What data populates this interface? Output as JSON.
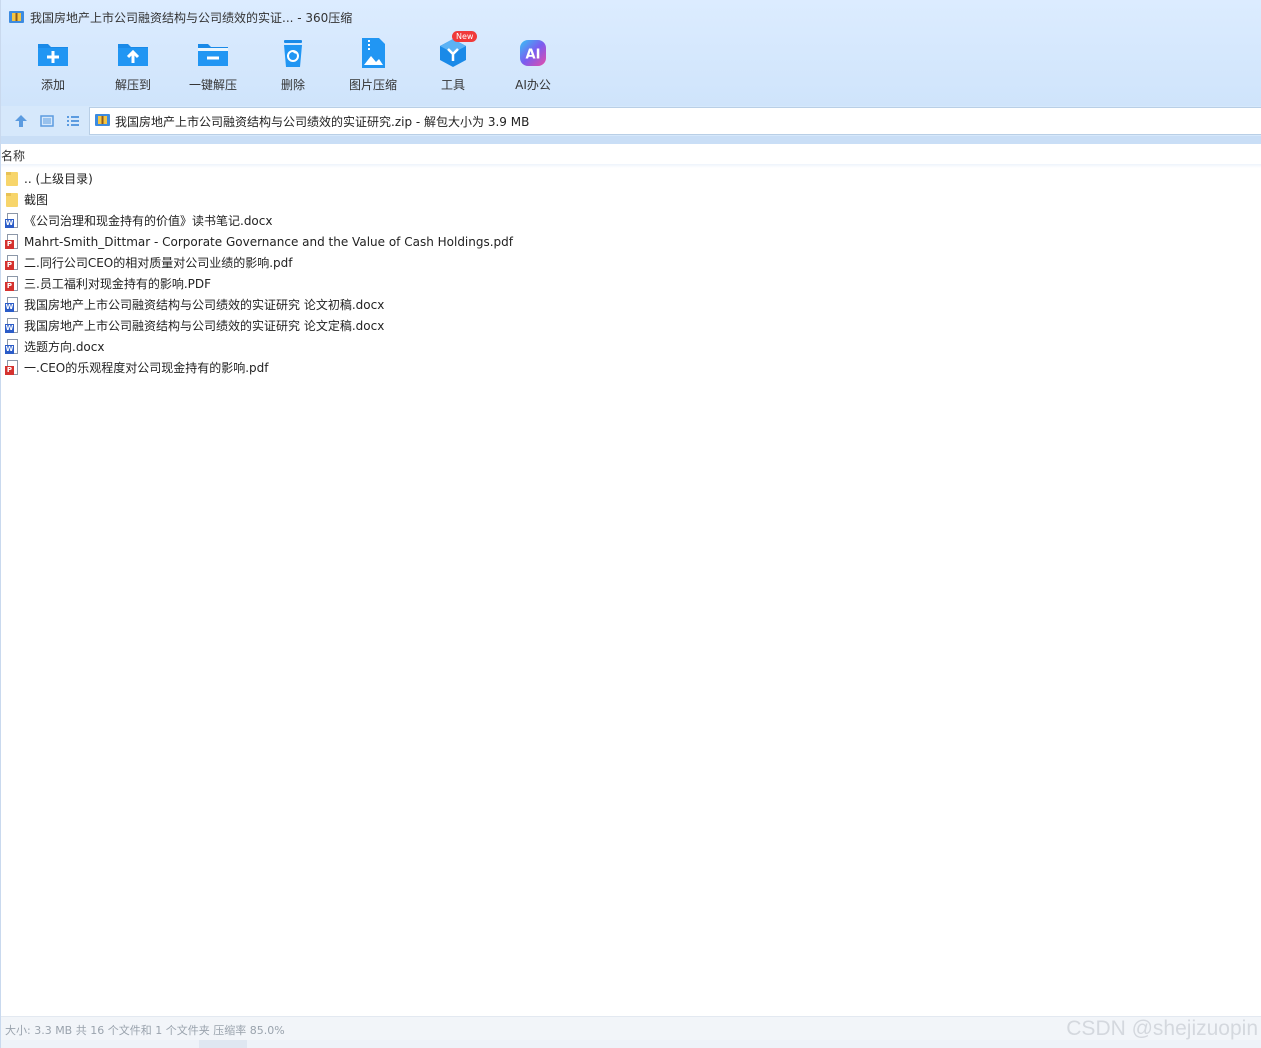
{
  "window": {
    "title": "我国房地产上市公司融资结构与公司绩效的实证... - 360压缩"
  },
  "toolbar": [
    {
      "id": "add",
      "label": "添加",
      "icon": "add-folder-icon"
    },
    {
      "id": "extract-to",
      "label": "解压到",
      "icon": "extract-folder-icon"
    },
    {
      "id": "one-click-extract",
      "label": "一键解压",
      "icon": "one-click-extract-icon"
    },
    {
      "id": "delete",
      "label": "删除",
      "icon": "recycle-bin-icon"
    },
    {
      "id": "image-compress",
      "label": "图片压缩",
      "icon": "image-zip-icon"
    },
    {
      "id": "tools",
      "label": "工具",
      "icon": "tools-cube-icon",
      "badge": "New"
    },
    {
      "id": "ai-office",
      "label": "AI办公",
      "icon": "ai-icon",
      "icon_text": "AI"
    }
  ],
  "addressbar": {
    "path": "我国房地产上市公司融资结构与公司绩效的实证研究.zip - 解包大小为 3.9 MB"
  },
  "list": {
    "column_header": "名称",
    "rows": [
      {
        "name": ".. (上级目录)",
        "type": "folder"
      },
      {
        "name": "截图",
        "type": "folder"
      },
      {
        "name": "《公司治理和现金持有的价值》读书笔记.docx",
        "type": "docx"
      },
      {
        "name": "Mahrt-Smith_Dittmar - Corporate Governance and the Value of Cash Holdings.pdf",
        "type": "pdf"
      },
      {
        "name": "二.同行公司CEO的相对质量对公司业绩的影响.pdf",
        "type": "pdf"
      },
      {
        "name": "三.员工福利对现金持有的影响.PDF",
        "type": "pdf"
      },
      {
        "name": "我国房地产上市公司融资结构与公司绩效的实证研究 论文初稿.docx",
        "type": "docx"
      },
      {
        "name": "我国房地产上市公司融资结构与公司绩效的实证研究 论文定稿.docx",
        "type": "docx"
      },
      {
        "name": "选题方向.docx",
        "type": "docx"
      },
      {
        "name": "一.CEO的乐观程度对公司现金持有的影响.pdf",
        "type": "pdf"
      }
    ]
  },
  "statusbar": {
    "text": "大小: 3.3 MB 共 16 个文件和 1 个文件夹 压缩率 85.0%",
    "watermark": "CSDN @shejizuopin"
  },
  "colors": {
    "toolbar_bg": "#d6e8fb",
    "icon_blue": "#1a8ae8",
    "badge_red": "#f03a3a",
    "docx_blue": "#2b5cc8",
    "pdf_red": "#d5322f",
    "folder_yellow": "#f7d56b"
  }
}
